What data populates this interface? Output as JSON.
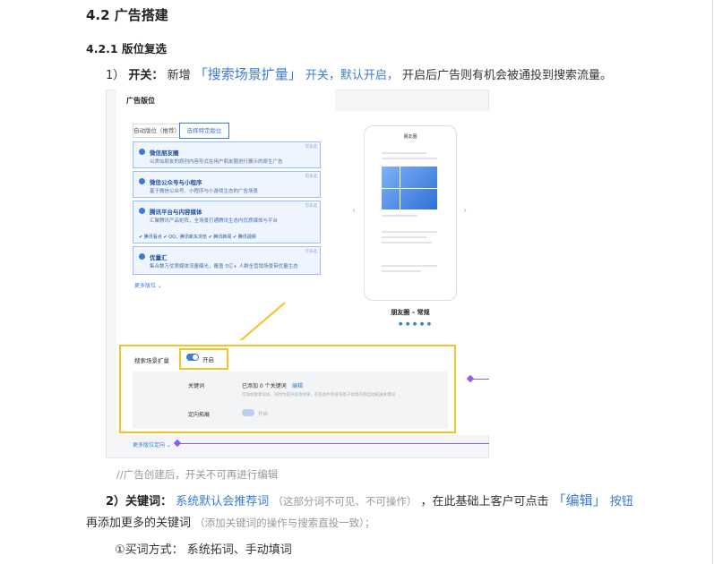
{
  "doc": {
    "h2": "4.2 广告搭建",
    "h3": "4.2.1 版位复选",
    "p1": {
      "num": "1）",
      "label": "开关：",
      "pre": "新增",
      "blue_big": "「搜索场景扩量」",
      "blue": "开关，默认开启，",
      "post": "开启后广告则有机会被通投到搜索流量。"
    },
    "caption": "//广告创建后，开关不可再进行编辑",
    "p2": {
      "label": "2）关键词：",
      "blue": "系统默认会推荐词",
      "gray": "（这部分词不可见、不可操作）",
      "mid": "，在此基础上客户可点击",
      "blue_big": "「编辑」",
      "blue_end": "按钮"
    },
    "p3": {
      "pre": "再添加更多的关键词",
      "gray": "（添加关键词的操作与搜索直投一致）；"
    },
    "p4": {
      "pre": "①买词方式：",
      "post": "系统拓词、手动填词"
    }
  },
  "screenshot": {
    "panel_title": "广告版位",
    "tab_auto": "自动版位（推荐）",
    "tab_select": "选择特定版位",
    "cards": [
      {
        "title": "微信朋友圈",
        "desc": "以类似朋友的原创内容形式在用户朋友圈进行展示的原生广告",
        "tag": "可多选"
      },
      {
        "title": "微信公众号与小程序",
        "desc": "基于微信公众号、小程序与小游戏生态的广告场景",
        "tag": "可多选"
      },
      {
        "title": "腾讯平台与内容媒体",
        "desc": "汇聚腾讯产品矩阵，全场景打通腾讯生态内优质媒体与平台",
        "tag": "可多选"
      },
      {
        "title": "优量汇",
        "desc": "集合数万优质媒体流量曝光，覆盖 5亿+ 人群全营销场景带优量生态",
        "tag": "可多选"
      }
    ],
    "sub_items": "✔ 腾讯看点   ✔ QQ、腾讯新东浏览   ✔ 腾讯新闻   ✔ 腾讯视频",
    "more_label": "更多版位 ⌄",
    "phone_header": "朋友圈",
    "phone_caption": "朋友圈 – 常规",
    "dots": "● ● ● ● ●",
    "search_label": "搜索场景扩量",
    "toggle_text": "开启",
    "kw_label": "关键词",
    "kw_value": "已添加 0 个关键词",
    "kw_edit": "编辑",
    "kw_note": "可添加搜索词语，同时为提升投放效果，在投放中系统将基于创意内容自动拓展关键词",
    "dx_label": "定向拓展",
    "dx_toggle": "开启",
    "more_target": "更多版位定向 ⌄"
  }
}
